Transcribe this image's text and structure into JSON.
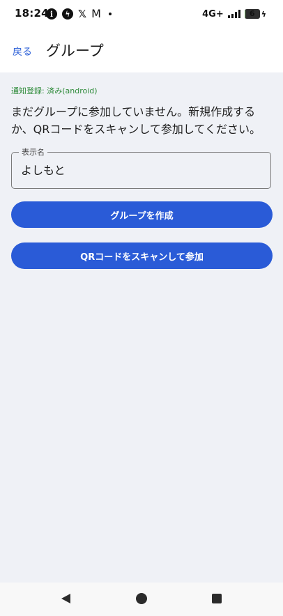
{
  "status_bar": {
    "time": "18:24",
    "left_icons": [
      "info-icon",
      "messenger-icon",
      "x-icon",
      "gmail-icon",
      "dot-icon"
    ],
    "network": "4G+",
    "battery_level": "6",
    "battery_fraction": 0.06
  },
  "header": {
    "back_label": "戻る",
    "title": "グループ"
  },
  "main": {
    "notice": "通知登録: 済み(android)",
    "message": "まだグループに参加していません。新規作成するか、QRコードをスキャンして参加してください。",
    "display_name": {
      "label": "表示名",
      "value": "よしもと"
    },
    "create_button": "グループを作成",
    "scan_button": "QRコードをスキャンして参加"
  },
  "nav": {
    "icons": [
      "back-triangle-icon",
      "home-circle-icon",
      "recents-square-icon"
    ]
  },
  "colors": {
    "accent": "#2a5bd7",
    "link": "#2f62d8",
    "notice_green": "#2e8b3a",
    "background": "#eff1f6"
  }
}
